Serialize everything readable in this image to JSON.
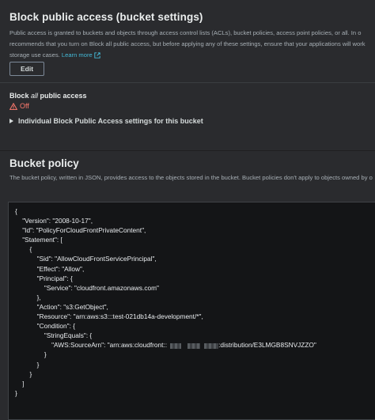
{
  "block_public_access": {
    "title": "Block public access (bucket settings)",
    "description": "Public access is granted to buckets and objects through access control lists (ACLs), bucket policies, access point policies, or all. In order to ensure that public access to this bucket and its objects is blocked, turn on Block all public access. These settings apply only to this bucket and its access points. AWS recommends that you turn on Block all public access, but before applying any of these settings, ensure that your applications will work correctly without public access. If you require some level of public access to this bucket or objects within, you can customize the individual settings below to suit your specific storage use cases.",
    "desc_line1": "Public access is granted to buckets and objects through access control lists (ACLs), bucket policies, access point policies, or all. In o",
    "desc_line2": "recommends that you turn on Block all public access, but before applying any of these settings, ensure that your applications will work",
    "desc_line3": "storage use cases.",
    "learn_more": "Learn more",
    "edit_label": "Edit",
    "status_label_prefix": "Block ",
    "status_label_em": "all",
    "status_label_suffix": " public access",
    "status_value": "Off",
    "expander_label": "Individual Block Public Access settings for this bucket"
  },
  "bucket_policy": {
    "title": "Bucket policy",
    "description": "The bucket policy, written in JSON, provides access to the objects stored in the bucket. Bucket policies don't apply to objects owned by o",
    "code_lines": [
      "{",
      "    \"Version\": \"2008-10-17\",",
      "    \"Id\": \"PolicyForCloudFrontPrivateContent\",",
      "    \"Statement\": [",
      "        {",
      "            \"Sid\": \"AllowCloudFrontServicePrincipal\",",
      "            \"Effect\": \"Allow\",",
      "            \"Principal\": {",
      "                \"Service\": \"cloudfront.amazonaws.com\"",
      "            },",
      "            \"Action\": \"s3:GetObject\",",
      "            \"Resource\": \"arn:aws:s3:::test-021db14a-development/*\",",
      "            \"Condition\": {",
      "                \"StringEquals\": {",
      "                    \"AWS:SourceArn\": \"arn:aws:cloudfront::",
      "                }",
      "            }",
      "        }",
      "    ]",
      "}"
    ],
    "arn_suffix": ":distribution/E3LMGB8SNVJZZO\""
  },
  "colors": {
    "background": "#2a2b2e",
    "code_background": "#141517",
    "link": "#44b9d6",
    "warning": "#ff7a6e"
  }
}
